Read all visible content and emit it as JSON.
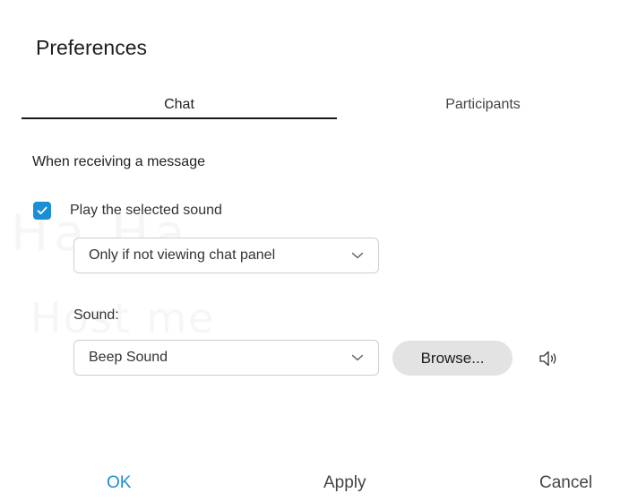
{
  "dialog": {
    "title": "Preferences"
  },
  "tabs": [
    {
      "label": "Chat",
      "selected": true
    },
    {
      "label": "Participants",
      "selected": false
    }
  ],
  "section": {
    "label": "When receiving a message"
  },
  "play_sound": {
    "label": "Play the selected sound",
    "checked": true
  },
  "when_select": {
    "value": "Only if not viewing chat panel"
  },
  "sound": {
    "label": "Sound:",
    "value": "Beep Sound",
    "browse_label": "Browse..."
  },
  "footer": {
    "ok_label": "OK",
    "apply_label": "Apply",
    "cancel_label": "Cancel"
  },
  "colors": {
    "accent": "#1a8fd6",
    "button_gray": "#e3e3e3"
  },
  "icons": {
    "checkbox": "check-icon",
    "dropdown": "chevron-down-icon",
    "preview": "speaker-icon"
  }
}
